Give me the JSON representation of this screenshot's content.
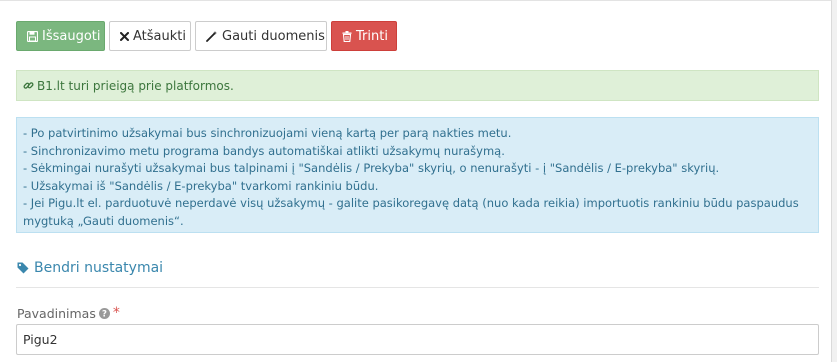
{
  "toolbar": {
    "save_label": "Išsaugoti",
    "cancel_label": "Atšaukti",
    "fetch_label": "Gauti duomenis",
    "delete_label": "Trinti"
  },
  "status": {
    "message": "B1.lt turi prieigą prie platformos."
  },
  "info": {
    "lines": [
      "- Po patvirtinimo užsakymai bus sinchronizuojami vieną kartą per parą nakties metu.",
      "- Sinchronizavimo metu programa bandys automatiškai atlikti užsakymų nurašymą.",
      "- Sėkmingai nurašyti užsakymai bus talpinami į \"Sandėlis / Prekyba\" skyrių, o nenurašyti - į \"Sandėlis / E-prekyba\" skyrių.",
      "- Užsakymai iš \"Sandėlis / E-prekyba\" tvarkomi rankiniu būdu.",
      "- Jei Pigu.lt el. parduotuvė neperdavė visų užsakymų - galite pasikoregavę datą (nuo kada reikia) importuotis rankiniu būdu paspaudus",
      "mygtuką „Gauti duomenis“."
    ]
  },
  "section": {
    "title": "Bendri nustatymai"
  },
  "form": {
    "name_label": "Pavadinimas",
    "required_mark": "*",
    "name_value": "Pigu2"
  },
  "colors": {
    "success": "#7bb77f",
    "danger": "#d9534f",
    "info_bg": "#d9edf7",
    "ok_bg": "#dff0d8",
    "section_title": "#3a87ad"
  },
  "icons": {
    "save": "save-icon",
    "cancel": "close-icon",
    "fetch": "magic-wand-icon",
    "delete": "trash-icon",
    "link": "link-icon",
    "tag": "tag-icon",
    "help": "question-icon"
  }
}
